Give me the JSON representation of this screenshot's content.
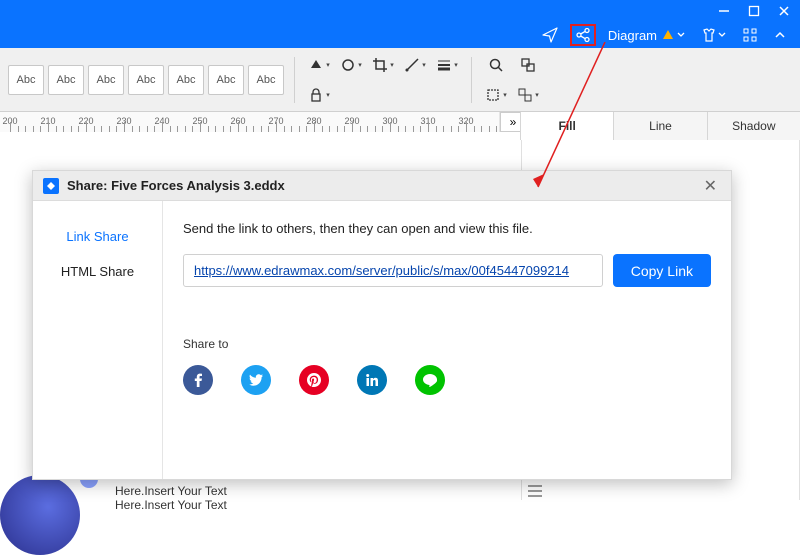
{
  "window": {
    "minimize": "–",
    "maximize": "❐",
    "close": "✕"
  },
  "menubar": {
    "diagram_label": "Diagram"
  },
  "toolbar": {
    "swatch": "Abc"
  },
  "ruler": {
    "ticks": [
      200,
      210,
      220,
      230,
      240,
      250,
      260,
      270,
      280,
      290,
      300,
      310,
      320
    ]
  },
  "side_panel": {
    "tabs": {
      "fill": "Fill",
      "line": "Line",
      "shadow": "Shadow"
    }
  },
  "canvas": {
    "text": "Here.Insert Your Text\nHere.Insert Your Text"
  },
  "dialog": {
    "title": "Share: Five Forces Analysis 3.eddx",
    "sidebar": {
      "link": "Link Share",
      "html": "HTML Share"
    },
    "desc": "Send the link to others, then they can open and view this file.",
    "url": "https://www.edrawmax.com/server/public/s/max/00f45447099214",
    "copy": "Copy Link",
    "share_to": "Share to",
    "social": {
      "fb": "f",
      "tw": "t",
      "pi": "p",
      "li": "in",
      "lc": "L"
    }
  }
}
